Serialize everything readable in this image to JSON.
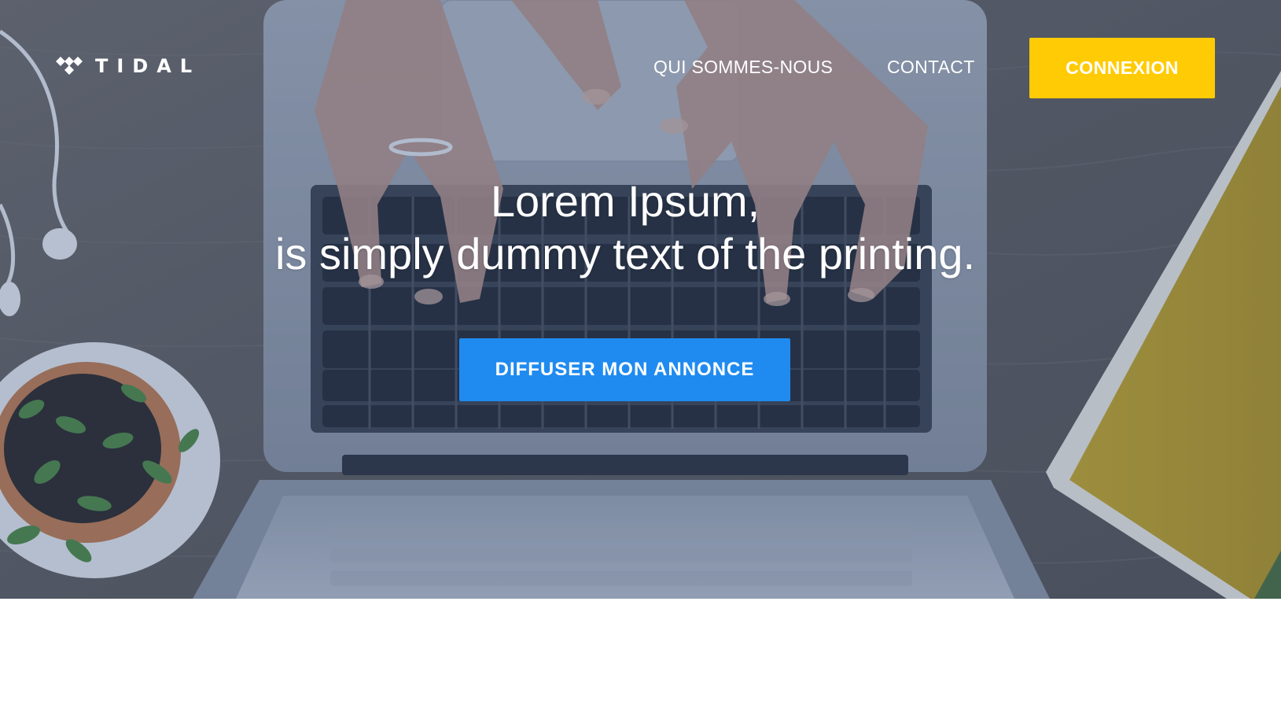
{
  "header": {
    "logo_text": "TIDAL",
    "nav": {
      "about_label": "QUI SOMMES-NOUS",
      "contact_label": "CONTACT"
    },
    "login_label": "CONNEXION"
  },
  "hero": {
    "headline_line1": "Lorem Ipsum,",
    "headline_line2": "is simply dummy text of the printing.",
    "cta_label": "DIFFUSER MON ANNONCE"
  },
  "colors": {
    "login_button": "#ffcb05",
    "cta_button": "#1f8bf0",
    "overlay": "#2c4c82",
    "text": "#ffffff"
  },
  "icons": {
    "logo_mark": "tidal-logo-icon"
  }
}
